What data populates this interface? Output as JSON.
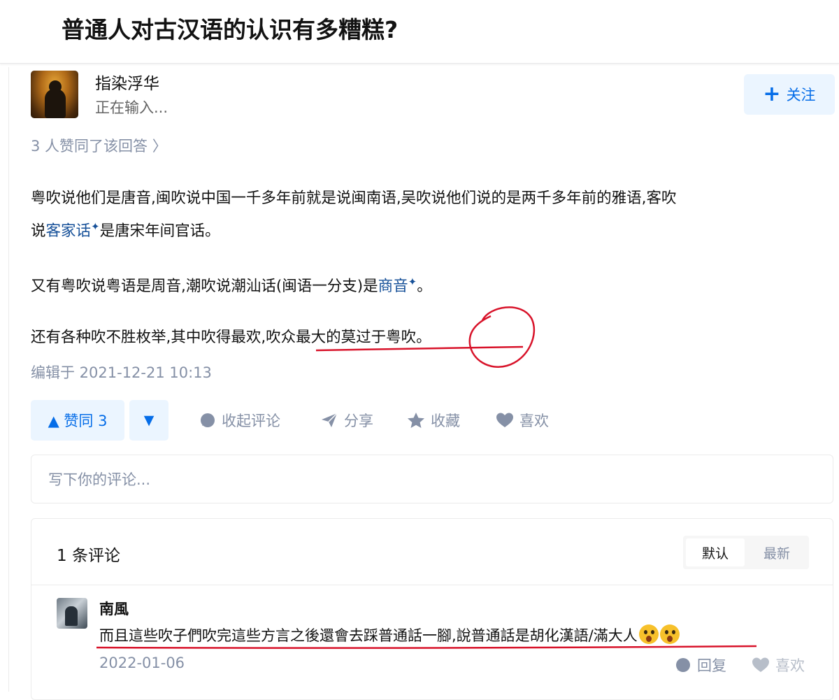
{
  "question": {
    "title": "普通人对古汉语的认识有多糟糕?"
  },
  "author": {
    "name": "指染浮华",
    "status": "正在输入...",
    "follow_label": "关注"
  },
  "answer": {
    "voters_text": "3 人赞同了该回答 〉",
    "p1_line1": "粤吹说他们是唐音,闽吹说中国一千多年前就是说闽南语,吴吹说他们说的是两千多年前的雅语,客吹",
    "p1_line2_pre": "说",
    "p1_link": "客家话",
    "p1_line2_post": "是唐宋年间官话。",
    "p2_pre": "又有粤吹说粤语是周音,潮吹说潮汕话(闽语一分支)是",
    "p2_link": "商音",
    "p2_post": "。",
    "p3": "还有各种吹不胜枚举,其中吹得最欢,吹众最大的莫过于粤吹。",
    "edited": "编辑于 2021-12-21 10:13"
  },
  "actions": {
    "vote_label": "▲ 赞同 3",
    "down_label": "▼",
    "collapse_comments": "收起评论",
    "share": "分享",
    "favorite": "收藏",
    "like": "喜欢"
  },
  "comment_input": {
    "placeholder": "写下你的评论..."
  },
  "comments": {
    "count_label": "1 条评论",
    "sort_default": "默认",
    "sort_latest": "最新",
    "items": [
      {
        "name": "南風",
        "text": "而且這些吹子們吹完這些方言之後還會去踩普通話一腳,說普通話是胡化漢語/滿大人",
        "date": "2022-01-06",
        "reply": "回复",
        "like": "喜欢"
      }
    ]
  },
  "colors": {
    "accent": "#056de8",
    "link": "#175199",
    "annotation": "#d8132a",
    "muted": "#8590a6"
  }
}
